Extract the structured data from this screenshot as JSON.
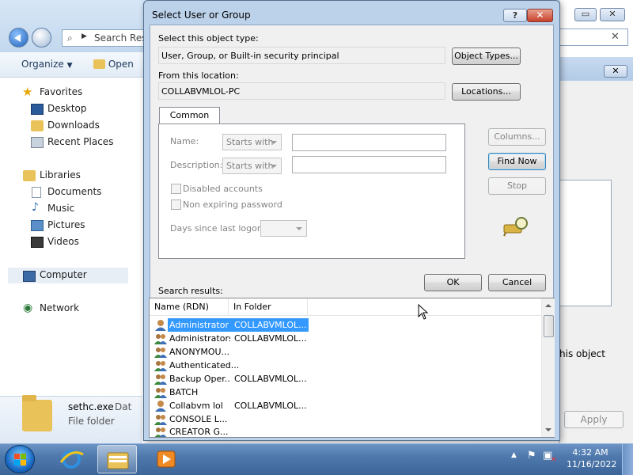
{
  "explorer": {
    "search_text": "Search Resu",
    "organize_label": "Organize",
    "open_label": "Open",
    "nav": {
      "favorites": "Favorites",
      "desktop": "Desktop",
      "downloads": "Downloads",
      "recent_places": "Recent Places",
      "libraries": "Libraries",
      "documents": "Documents",
      "music": "Music",
      "pictures": "Pictures",
      "videos": "Videos",
      "computer": "Computer",
      "network": "Network"
    },
    "details": {
      "file_name": "sethc.exe",
      "file_date_partial": "Dat",
      "file_type": "File folder"
    }
  },
  "properties": {
    "close_glyph": "✕",
    "text_partial": "his object",
    "apply_label": "Apply"
  },
  "dialog": {
    "title": "Select User or Group",
    "help_glyph": "?",
    "close_glyph": "✕",
    "object_type_label": "Select this object type:",
    "object_type_value": "User, Group, or Built-in security principal",
    "object_types_button": "Object Types...",
    "location_label": "From this location:",
    "location_value": "COLLABVMLOL-PC",
    "locations_button": "Locations...",
    "tab_label": "Common Queries",
    "name_label": "Name:",
    "name_combo": "Starts with",
    "description_label": "Description:",
    "description_combo": "Starts with",
    "disabled_accounts": "Disabled accounts",
    "non_expiring": "Non expiring password",
    "days_label": "Days since last logon:",
    "columns_button": "Columns...",
    "find_now_button": "Find Now",
    "stop_button": "Stop",
    "ok_button": "OK",
    "cancel_button": "Cancel",
    "search_results_label": "Search results:",
    "columns": [
      "Name (RDN)",
      "In Folder"
    ],
    "results": [
      {
        "name": "Administrator",
        "folder": "COLLABVMLOL...",
        "icon": "user-icon"
      },
      {
        "name": "Administrators",
        "folder": "COLLABVMLOL...",
        "icon": "group-icon"
      },
      {
        "name": "ANONYMOU...",
        "folder": "",
        "icon": "group-icon"
      },
      {
        "name": "Authenticated...",
        "folder": "",
        "icon": "group-icon"
      },
      {
        "name": "Backup Oper...",
        "folder": "COLLABVMLOL...",
        "icon": "group-icon"
      },
      {
        "name": "BATCH",
        "folder": "",
        "icon": "group-icon"
      },
      {
        "name": "Collabvm lol",
        "folder": "COLLABVMLOL...",
        "icon": "user-icon"
      },
      {
        "name": "CONSOLE L...",
        "folder": "",
        "icon": "group-icon"
      },
      {
        "name": "CREATOR G...",
        "folder": "",
        "icon": "group-icon"
      }
    ]
  },
  "taskbar": {
    "time": "4:32 AM",
    "date": "11/16/2022"
  }
}
